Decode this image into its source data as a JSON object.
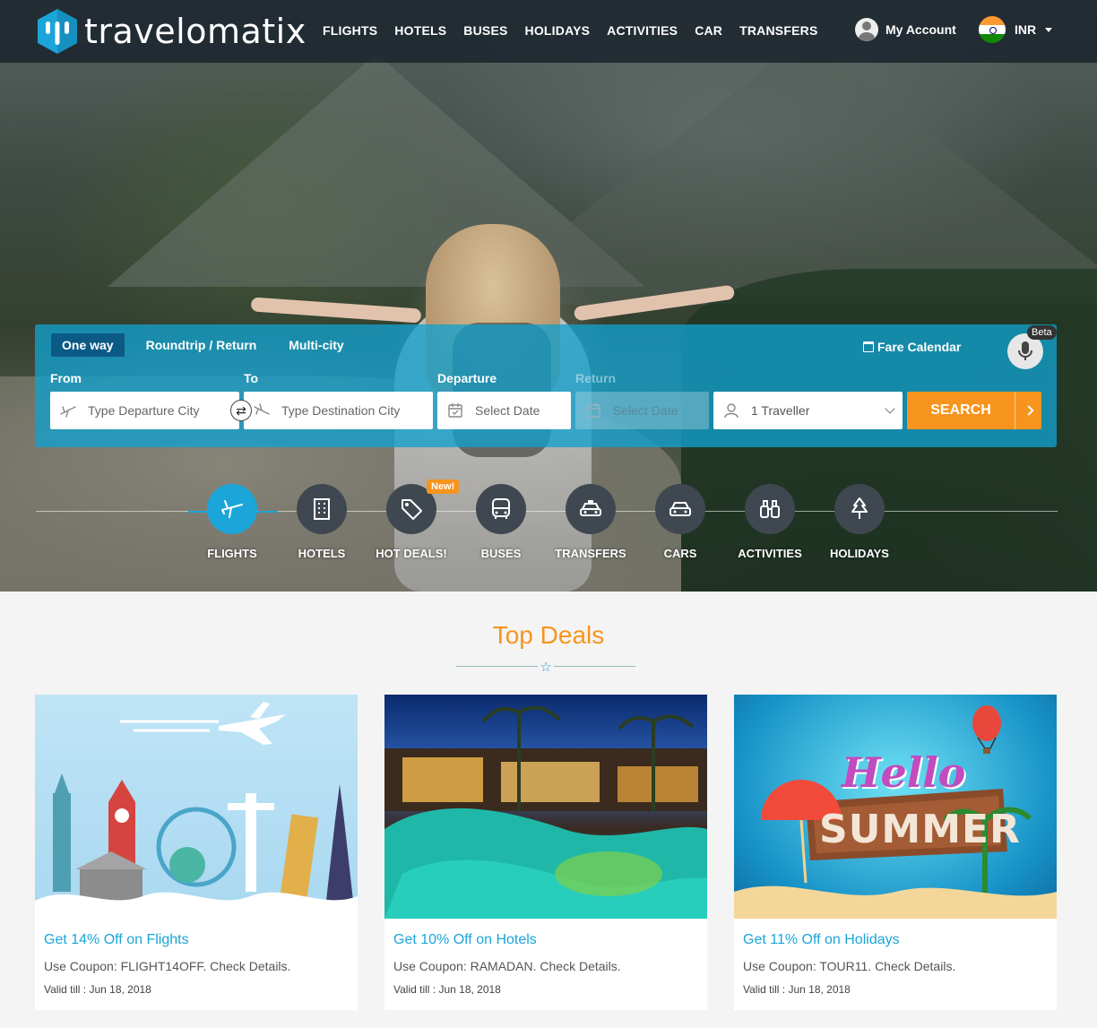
{
  "brand": {
    "name": "travelomatix",
    "accent": "#1ba5d8",
    "orange": "#f7941d"
  },
  "nav": {
    "items": [
      "FLIGHTS",
      "HOTELS",
      "BUSES",
      "HOLIDAYS",
      "ACTIVITIES",
      "CAR",
      "TRANSFERS"
    ]
  },
  "account": {
    "label": "My Account"
  },
  "currency": {
    "code": "INR"
  },
  "search": {
    "tabs": [
      "One way",
      "Roundtrip / Return",
      "Multi-city"
    ],
    "active_tab": "One way",
    "fare_calendar": "Fare Calendar",
    "beta": "Beta",
    "labels": {
      "from": "From",
      "to": "To",
      "departure": "Departure",
      "return": "Return"
    },
    "placeholders": {
      "from": "Type Departure City",
      "to": "Type Destination City",
      "departure": "Select Date",
      "return": "Select Date"
    },
    "travellers": "1 Traveller",
    "button": "SEARCH"
  },
  "categories": {
    "items": [
      "FLIGHTS",
      "HOTELS",
      "HOT DEALS!",
      "BUSES",
      "TRANSFERS",
      "CARS",
      "ACTIVITIES",
      "HOLIDAYS"
    ],
    "active": "FLIGHTS",
    "new_badge": "New!"
  },
  "deals": {
    "title": "Top Deals",
    "items": [
      {
        "title": "Get 14% Off on Flights",
        "desc": "Use Coupon: FLIGHT14OFF. Check Details.",
        "valid": "Valid till : Jun 18, 2018"
      },
      {
        "title": "Get 10% Off on Hotels",
        "desc": "Use Coupon: RAMADAN. Check Details.",
        "valid": "Valid till : Jun 18, 2018"
      },
      {
        "title": "Get 11% Off on Holidays",
        "desc": "Use Coupon: TOUR11. Check Details.",
        "valid": "Valid till : Jun 18, 2018"
      }
    ],
    "holiday_sign": {
      "line1": "Hello",
      "line2": "SUMMER"
    }
  }
}
